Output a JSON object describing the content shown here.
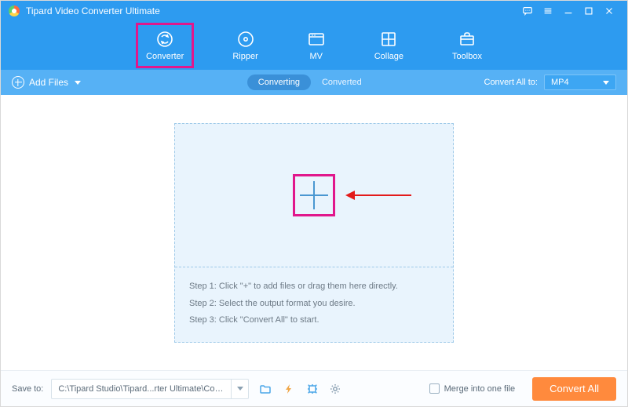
{
  "titlebar": {
    "app_name": "Tipard Video Converter Ultimate"
  },
  "nav": {
    "items": [
      {
        "label": "Converter"
      },
      {
        "label": "Ripper"
      },
      {
        "label": "MV"
      },
      {
        "label": "Collage"
      },
      {
        "label": "Toolbox"
      }
    ]
  },
  "subbar": {
    "add_files_label": "Add Files",
    "seg_converting": "Converting",
    "seg_converted": "Converted",
    "convert_all_to_label": "Convert All to:",
    "convert_all_to_value": "MP4"
  },
  "dropzone": {
    "steps": [
      "Step 1: Click \"+\" to add files or drag them here directly.",
      "Step 2: Select the output format you desire.",
      "Step 3: Click \"Convert All\" to start."
    ]
  },
  "footer": {
    "save_to_label": "Save to:",
    "save_to_path": "C:\\Tipard Studio\\Tipard...rter Ultimate\\Converted",
    "merge_label": "Merge into one file",
    "convert_all_button": "Convert All"
  }
}
